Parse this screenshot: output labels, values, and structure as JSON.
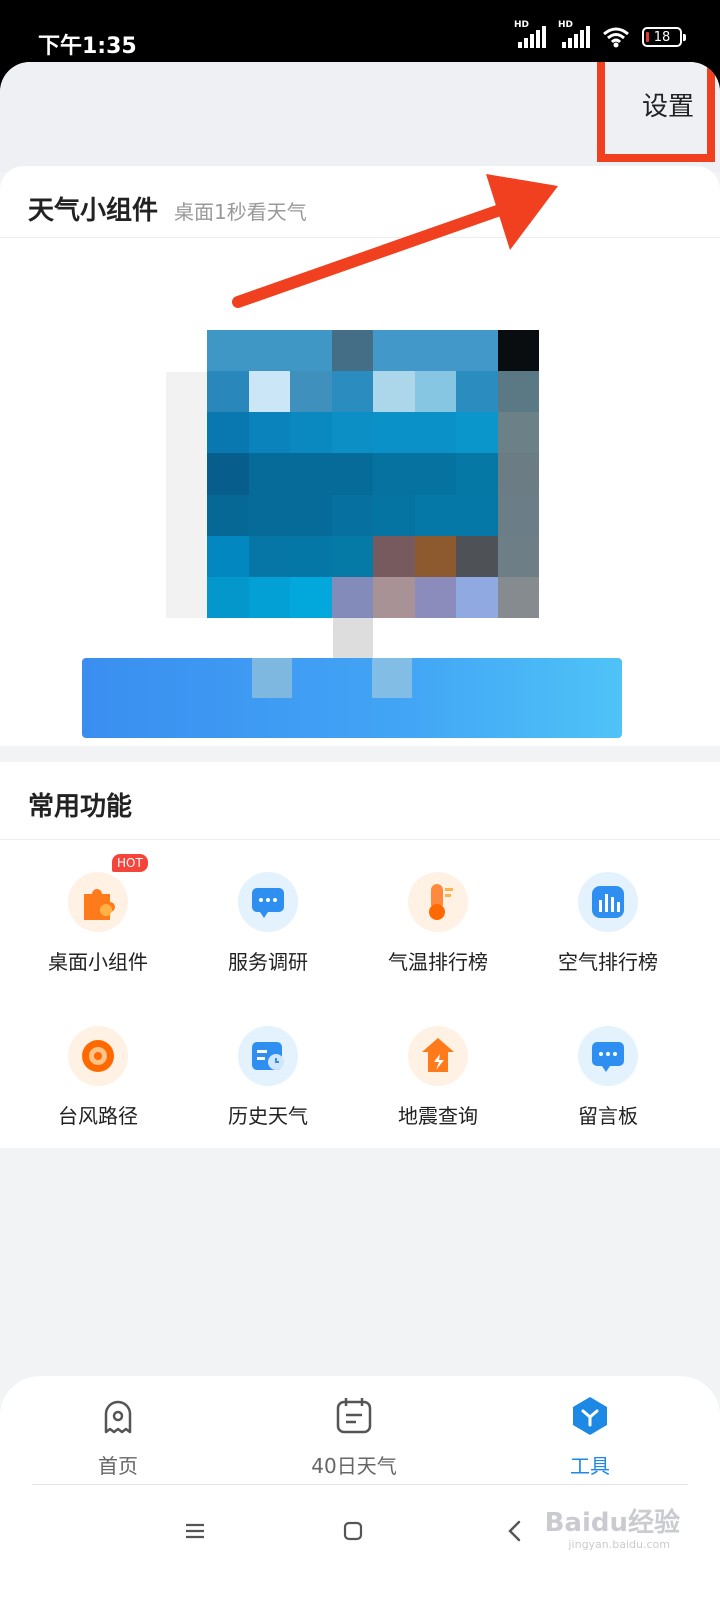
{
  "status_bar": {
    "time": "下午1:35",
    "network1": "HD",
    "network2": "HD",
    "battery": "18"
  },
  "header": {
    "settings_label": "设置"
  },
  "widget_section": {
    "title": "天气小组件",
    "subtitle": "桌面1秒看天气"
  },
  "functions_section": {
    "title": "常用功能",
    "hot_badge": "HOT",
    "items": [
      {
        "label": "桌面小组件",
        "icon": "puzzle-icon"
      },
      {
        "label": "服务调研",
        "icon": "chat-icon"
      },
      {
        "label": "气温排行榜",
        "icon": "thermometer-icon"
      },
      {
        "label": "空气排行榜",
        "icon": "bar-chart-icon"
      },
      {
        "label": "台风路径",
        "icon": "typhoon-icon"
      },
      {
        "label": "历史天气",
        "icon": "history-calendar-icon"
      },
      {
        "label": "地震查询",
        "icon": "earthquake-icon"
      },
      {
        "label": "留言板",
        "icon": "message-board-icon"
      }
    ]
  },
  "bottom_nav": {
    "items": [
      {
        "label": "首页",
        "icon": "home-icon"
      },
      {
        "label": "40日天气",
        "icon": "calendar-icon"
      },
      {
        "label": "工具",
        "icon": "tools-icon"
      }
    ],
    "active": "工具"
  },
  "watermark": {
    "text": "Baidu经验",
    "sub": "jingyan.baidu.com"
  },
  "colors": {
    "accent_blue": "#1e88e5",
    "annotation_red": "#f0401f",
    "hot_red": "#f4443b"
  }
}
